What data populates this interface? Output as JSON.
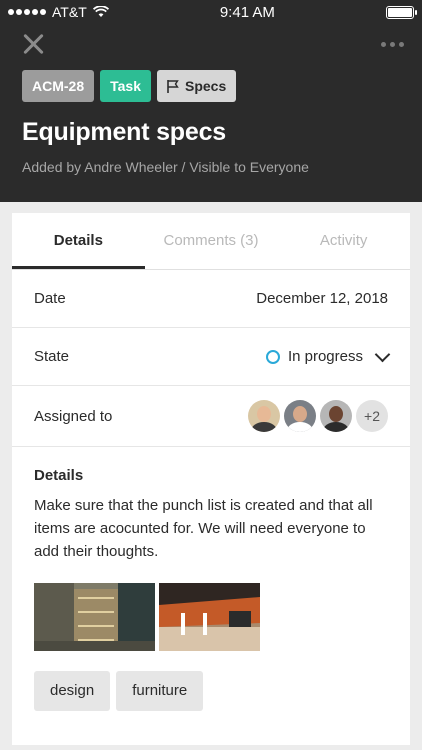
{
  "status": {
    "carrier": "AT&T",
    "time": "9:41 AM"
  },
  "toolbar": {
    "close_icon": "close-icon",
    "more_icon": "more-icon"
  },
  "tags": {
    "id": "ACM-28",
    "type": "Task",
    "flag_label": "Specs"
  },
  "header": {
    "title": "Equipment specs",
    "subtitle": "Added by Andre Wheeler  /  Visible to Everyone"
  },
  "tabs": [
    {
      "label": "Details",
      "active": true
    },
    {
      "label": "Comments (3)",
      "active": false
    },
    {
      "label": "Activity",
      "active": false
    }
  ],
  "fields": {
    "date_label": "Date",
    "date_value": "December 12, 2018",
    "state_label": "State",
    "state_value": "In progress",
    "assigned_label": "Assigned to",
    "assigned_more": "+2"
  },
  "details": {
    "heading": "Details",
    "body": "Make sure that the punch list is created and that all items are acocunted for. We will need everyone to add their thoughts."
  },
  "chips": [
    "design",
    "furniture"
  ],
  "colors": {
    "header_bg": "#2b2b2b",
    "task_tag": "#2dbd94",
    "state_ring": "#2aa9d8"
  }
}
